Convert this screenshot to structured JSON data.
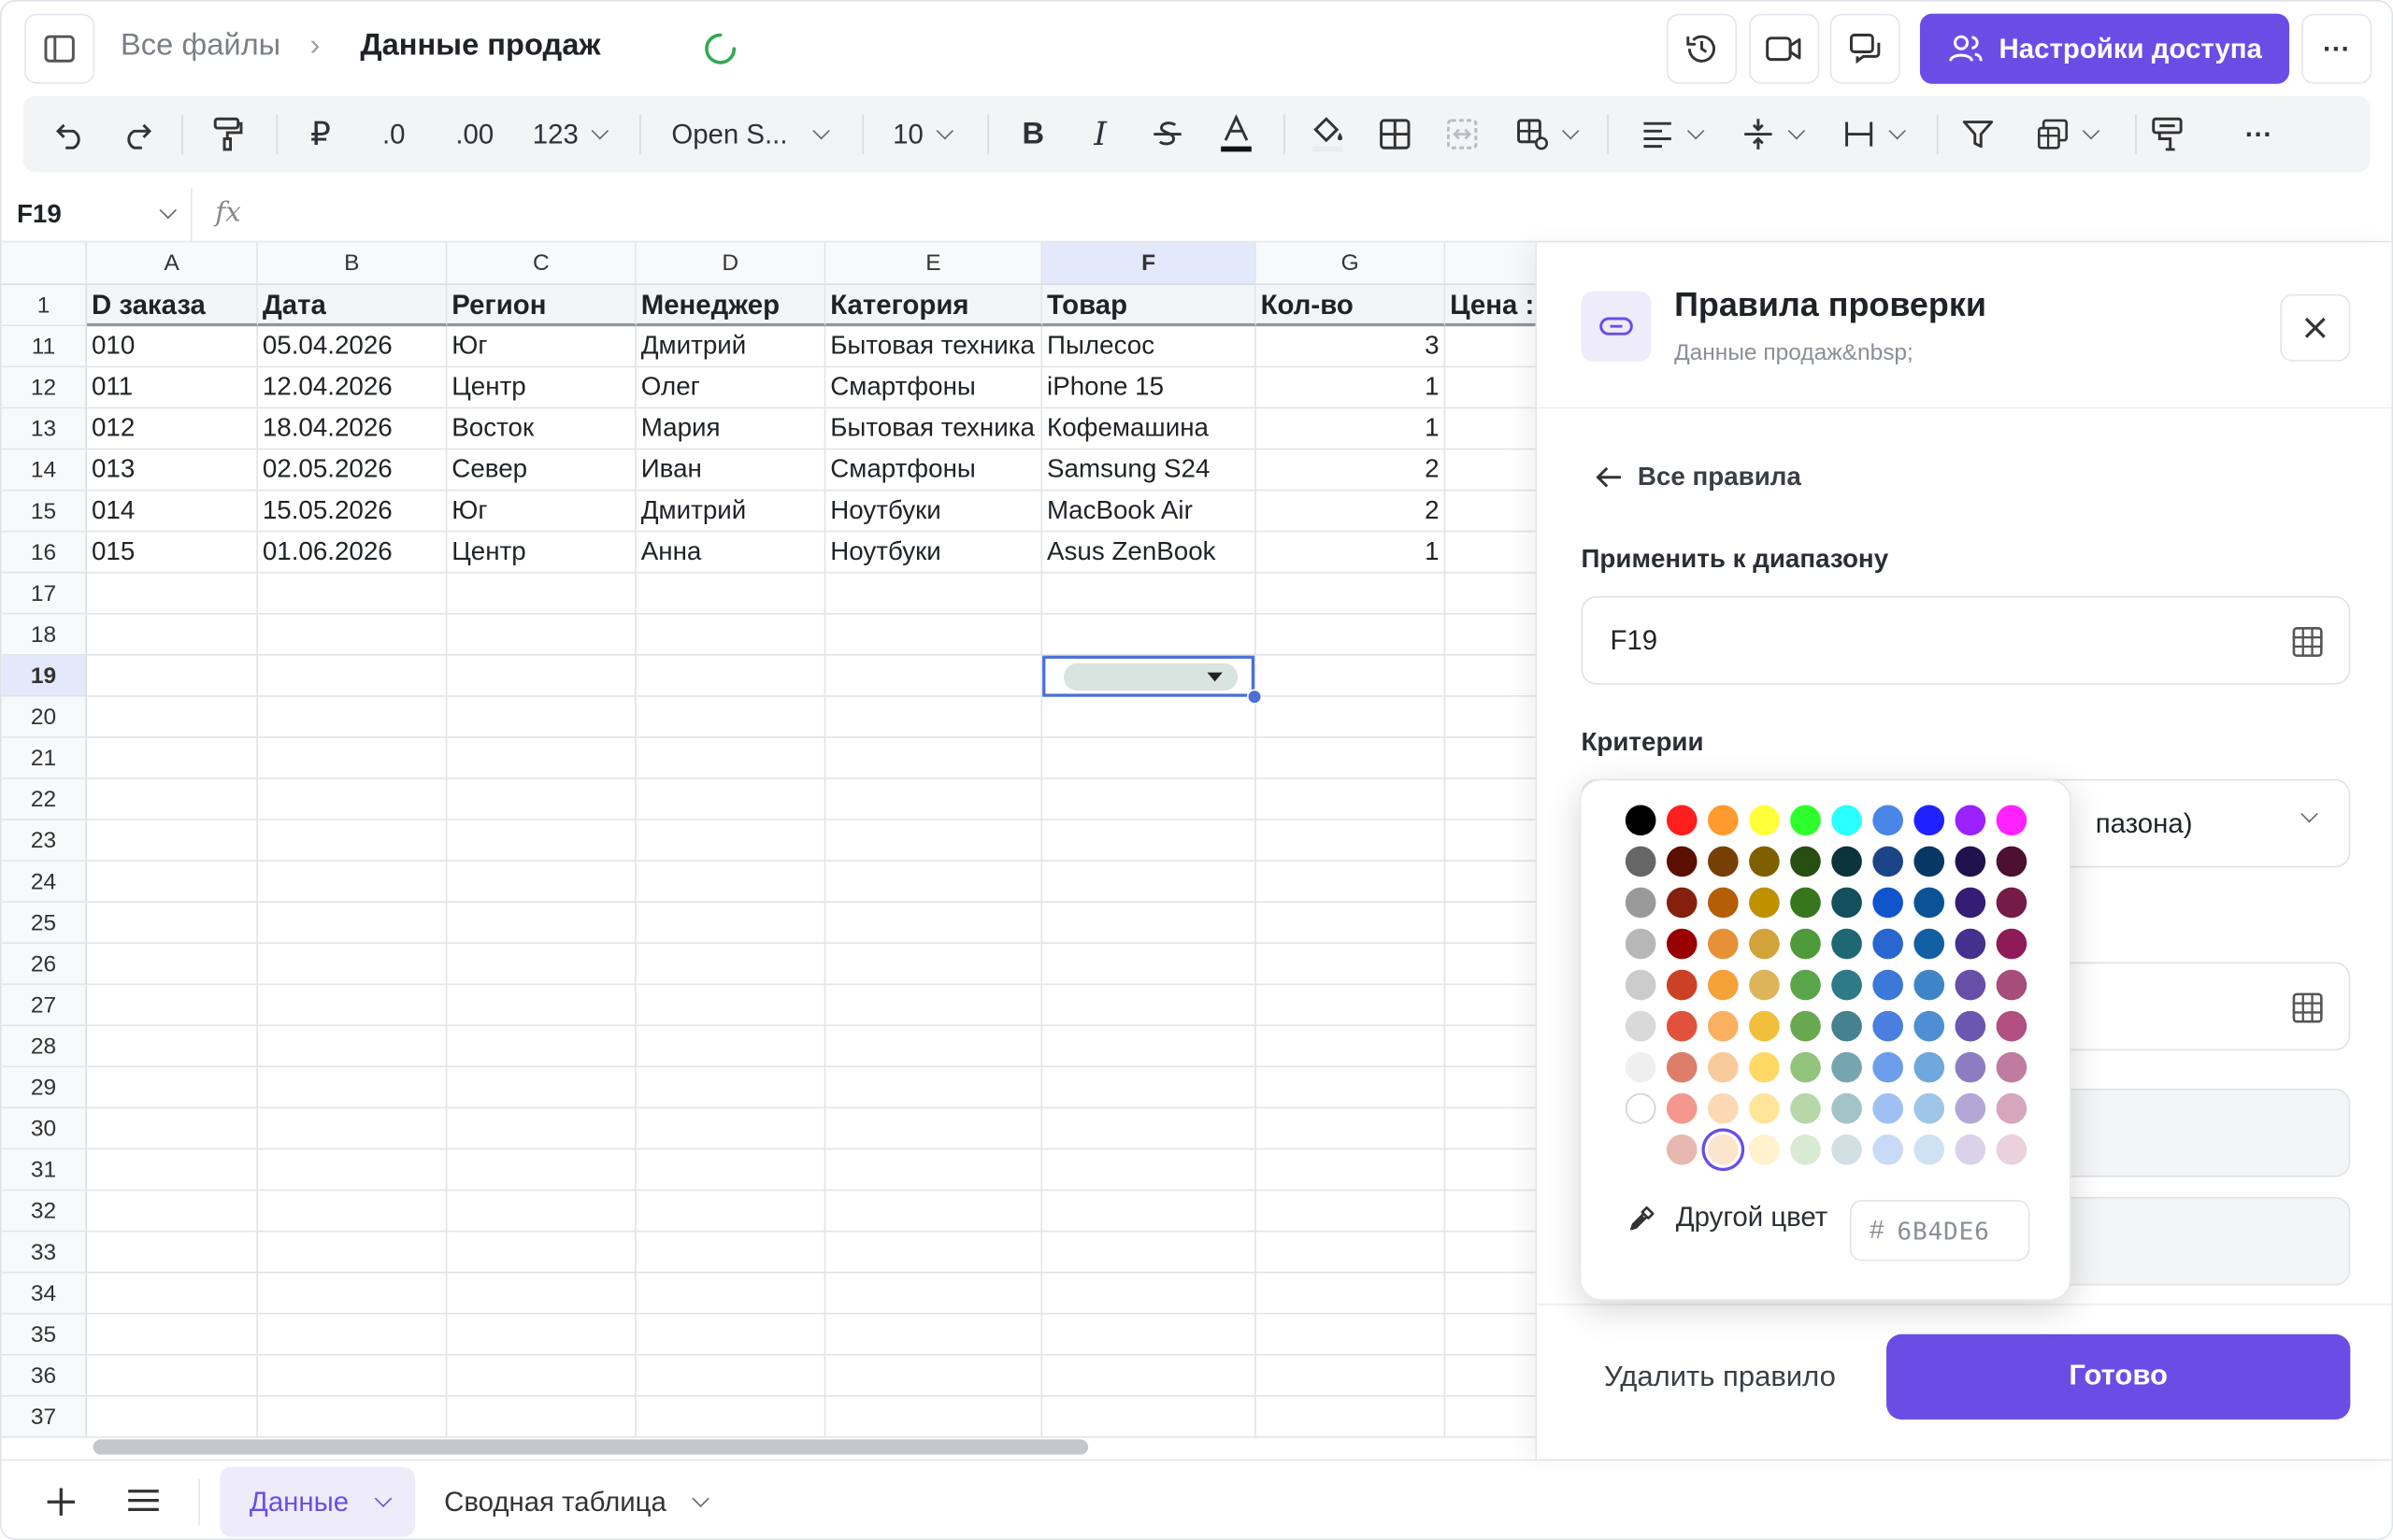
{
  "topbar": {
    "breadcrumb_root": "Все файлы",
    "breadcrumb_sep": "›",
    "doc_title": "Данные продаж",
    "share_label": "Настройки доступа",
    "more_label": "···"
  },
  "toolbar": {
    "currency": "₽",
    "dec_less": ".0",
    "dec_more": ".00",
    "format": "123",
    "font": "Open S...",
    "size": "10",
    "bold": "B",
    "italic": "I",
    "more": "···"
  },
  "formula_bar": {
    "cell_ref": "F19",
    "fx": "fx"
  },
  "grid": {
    "columns": [
      "A",
      "B",
      "C",
      "D",
      "E",
      "F",
      "G"
    ],
    "header_row": {
      "num": "1",
      "cells": [
        "D заказа",
        "Дата",
        "Регион",
        "Менеджер",
        "Категория",
        "Товар",
        "Кол-во",
        "Цена :"
      ]
    },
    "rows": [
      {
        "num": "11",
        "cells": [
          "010",
          "05.04.2026",
          "Юг",
          "Дмитрий",
          "Бытовая техника",
          "Пылесос",
          "3"
        ]
      },
      {
        "num": "12",
        "cells": [
          "011",
          "12.04.2026",
          "Центр",
          "Олег",
          "Смартфоны",
          "iPhone 15",
          "1"
        ]
      },
      {
        "num": "13",
        "cells": [
          "012",
          "18.04.2026",
          "Восток",
          "Мария",
          "Бытовая техника",
          "Кофемашина",
          "1"
        ]
      },
      {
        "num": "14",
        "cells": [
          "013",
          "02.05.2026",
          "Север",
          "Иван",
          "Смартфоны",
          "Samsung S24",
          "2"
        ]
      },
      {
        "num": "15",
        "cells": [
          "014",
          "15.05.2026",
          "Юг",
          "Дмитрий",
          "Ноутбуки",
          "MacBook Air",
          "2"
        ]
      },
      {
        "num": "16",
        "cells": [
          "015",
          "01.06.2026",
          "Центр",
          "Анна",
          "Ноутбуки",
          "Asus ZenBook",
          "1"
        ]
      }
    ],
    "empty_rows": [
      "17",
      "18",
      "19",
      "20",
      "21",
      "22",
      "23",
      "24",
      "25",
      "26",
      "27",
      "28",
      "29",
      "30",
      "31",
      "32",
      "33",
      "34",
      "35",
      "36",
      "37"
    ],
    "selected_column": "F",
    "selected_row": "19"
  },
  "sheets": {
    "active": "Данные",
    "other": "Сводная таблица"
  },
  "panel": {
    "title": "Правила проверки",
    "subtitle": "Данные продаж&nbsp;",
    "back": "Все правила",
    "range_label": "Применить к диапазону",
    "range_value": "F19",
    "criteria_label": "Критерии",
    "criteria_partial": "пазона)",
    "delete": "Удалить правило",
    "done": "Готово"
  },
  "picker": {
    "other_color": "Другой цвет",
    "hex_prefix": "#",
    "hex_value": "6B4DE6",
    "selected": "row 8, col 2",
    "palette": [
      [
        "#000000",
        "#ff1f1f",
        "#ff9a2e",
        "#ffff3a",
        "#2cff2c",
        "#2cffff",
        "#4a86e8",
        "#1f22ff",
        "#9b22ff",
        "#ff22ff"
      ],
      [
        "#666666",
        "#5b0f00",
        "#783f04",
        "#7f6000",
        "#274e13",
        "#0c343d",
        "#1c4587",
        "#073763",
        "#20124d",
        "#4c1130"
      ],
      [
        "#999999",
        "#85200c",
        "#b45f06",
        "#bf9000",
        "#38761d",
        "#134f5c",
        "#1155cc",
        "#0b5394",
        "#351c75",
        "#741b47"
      ],
      [
        "#b7b7b7",
        "#990000",
        "#e69138",
        "#d1a33a",
        "#4f9a3b",
        "#1f6772",
        "#2a66d0",
        "#125fa3",
        "#44308f",
        "#8e1b58"
      ],
      [
        "#cccccc",
        "#cc4125",
        "#f6a23a",
        "#ddb45a",
        "#5aa54a",
        "#2e7a86",
        "#3c78d8",
        "#3d85c6",
        "#674ea7",
        "#a64d79"
      ],
      [
        "#d9d9d9",
        "#e0523c",
        "#f9b060",
        "#f0c03c",
        "#6aa84f",
        "#45818e",
        "#4a7fe0",
        "#4f8ed2",
        "#6b56b0",
        "#b04f80"
      ],
      [
        "#efefef",
        "#dd7e6b",
        "#f9cb9c",
        "#ffd966",
        "#93c47d",
        "#76a5af",
        "#6d9eeb",
        "#6fa8dc",
        "#8e7cc3",
        "#c27ba0"
      ],
      [
        "#ffffff",
        "#f4978e",
        "#fcd9b4",
        "#ffe599",
        "#b6d7a8",
        "#a2c4c9",
        "#9fc0f2",
        "#9fc5e8",
        "#b4a7d6",
        "#d5a6bd"
      ],
      [
        "",
        "#e6b8af",
        "#fce5cd",
        "#fff2cc",
        "#d9ead3",
        "#d0e0e3",
        "#c9daf8",
        "#cfe2f3",
        "#d9d2e9",
        "#ead1dc"
      ]
    ]
  }
}
